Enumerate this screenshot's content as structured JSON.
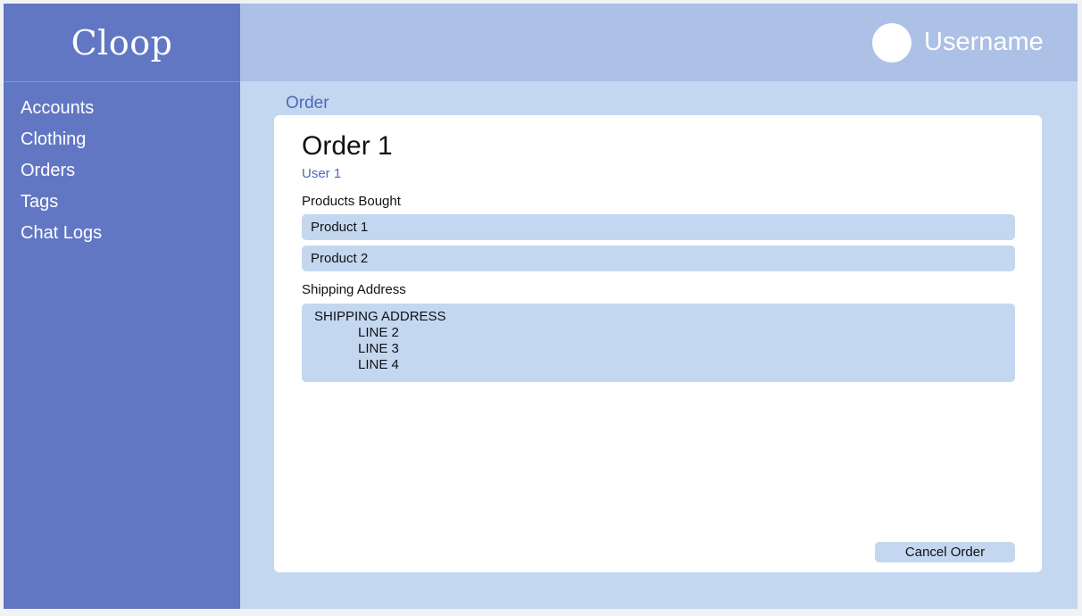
{
  "sidebar": {
    "brand": "Cloop",
    "items": [
      {
        "label": "Accounts"
      },
      {
        "label": "Clothing"
      },
      {
        "label": "Orders"
      },
      {
        "label": "Tags"
      },
      {
        "label": "Chat Logs"
      }
    ]
  },
  "header": {
    "username": "Username"
  },
  "breadcrumb": "Order",
  "order": {
    "title": "Order 1",
    "user": "User 1",
    "products_label": "Products Bought",
    "products": [
      "Product 1",
      "Product 2"
    ],
    "shipping_label": "Shipping Address",
    "address": [
      "SHIPPING ADDRESS",
      "LINE 2",
      "LINE 3",
      "LINE 4"
    ],
    "cancel_label": "Cancel Order"
  },
  "colors": {
    "sidebar": "#6177c3",
    "topbar": "#adc0e5",
    "content_bg": "#c4d7f0",
    "accent_text": "#4a6bb8"
  }
}
